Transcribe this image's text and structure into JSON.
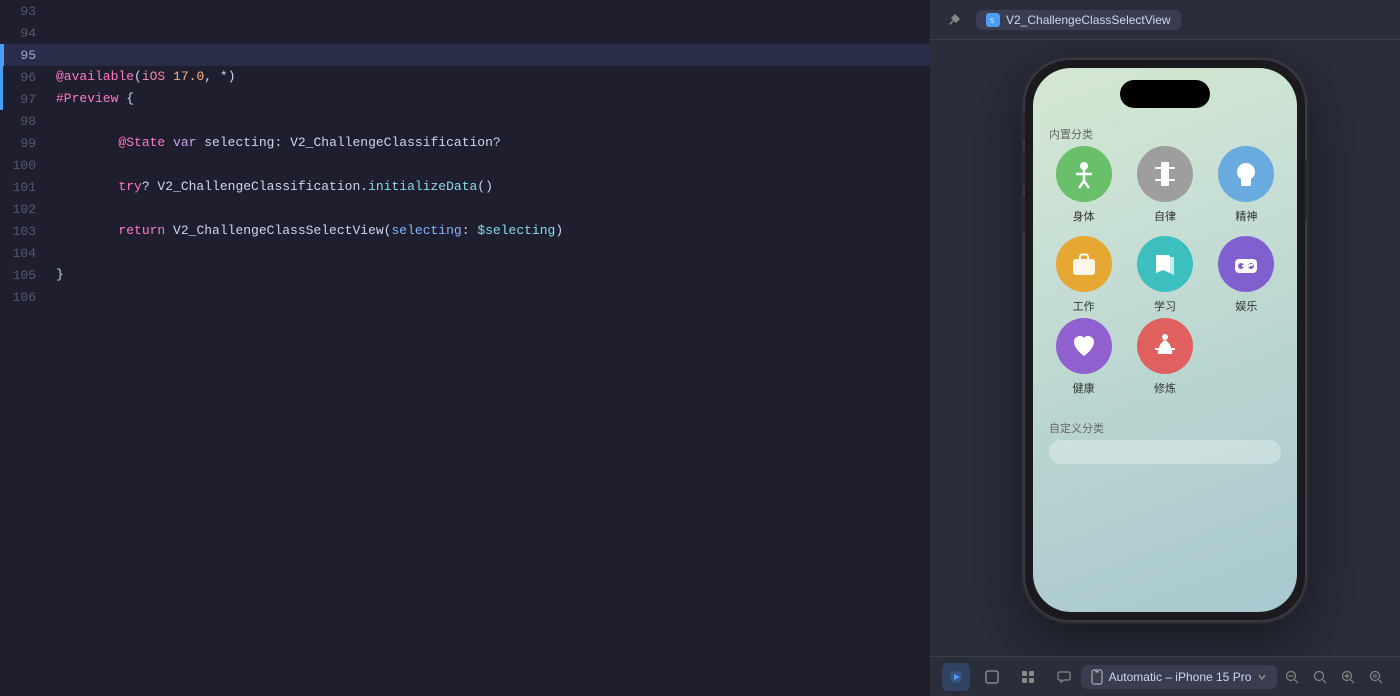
{
  "editor": {
    "lines": [
      {
        "number": 93,
        "content": "",
        "highlighted": false,
        "hasIndicator": false
      },
      {
        "number": 94,
        "content": "",
        "highlighted": false,
        "hasIndicator": false
      },
      {
        "number": 95,
        "content": "",
        "highlighted": true,
        "hasIndicator": true
      },
      {
        "number": 96,
        "content": "@available(iOS 17.0, *)",
        "highlighted": false,
        "hasIndicator": true
      },
      {
        "number": 97,
        "content": "#Preview {",
        "highlighted": false,
        "hasIndicator": true
      },
      {
        "number": 98,
        "content": "",
        "highlighted": false,
        "hasIndicator": false
      },
      {
        "number": 99,
        "content": "    @State var selecting: V2_ChallengeClassification?",
        "highlighted": false,
        "hasIndicator": false
      },
      {
        "number": 100,
        "content": "",
        "highlighted": false,
        "hasIndicator": false
      },
      {
        "number": 101,
        "content": "    try? V2_ChallengeClassification.initializeData()",
        "highlighted": false,
        "hasIndicator": false
      },
      {
        "number": 102,
        "content": "",
        "highlighted": false,
        "hasIndicator": false
      },
      {
        "number": 103,
        "content": "    return V2_ChallengeClassSelectView(selecting: $selecting)",
        "highlighted": false,
        "hasIndicator": false
      },
      {
        "number": 104,
        "content": "",
        "highlighted": false,
        "hasIndicator": false
      },
      {
        "number": 105,
        "content": "}",
        "highlighted": false,
        "hasIndicator": false
      },
      {
        "number": 106,
        "content": "",
        "highlighted": false,
        "hasIndicator": false
      }
    ]
  },
  "preview": {
    "toolbar": {
      "title": "V2_ChallengeClassSelectView",
      "pin_icon": "📌"
    },
    "phone": {
      "sections": [
        {
          "title": "内置分类",
          "items": [
            {
              "label": "身体",
              "icon": "🧍",
              "color": "#6abf6a"
            },
            {
              "label": "自律",
              "icon": "⚖",
              "color": "#9e9e9e"
            },
            {
              "label": "精神",
              "icon": "🧠",
              "color": "#6aabdf"
            },
            {
              "label": "工作",
              "icon": "💼",
              "color": "#e6a832"
            },
            {
              "label": "学习",
              "icon": "📖",
              "color": "#3dbfbf"
            },
            {
              "label": "娱乐",
              "icon": "🎮",
              "color": "#8060cf"
            },
            {
              "label": "健康",
              "icon": "❤️",
              "color": "#9060cf"
            },
            {
              "label": "修炼",
              "icon": "🧘",
              "color": "#e06060"
            }
          ]
        },
        {
          "title": "自定义分类"
        }
      ]
    },
    "bottom_bar": {
      "device_label": "Automatic – iPhone 15 Pro",
      "icons": [
        "▶",
        "□",
        "⊞"
      ]
    }
  }
}
